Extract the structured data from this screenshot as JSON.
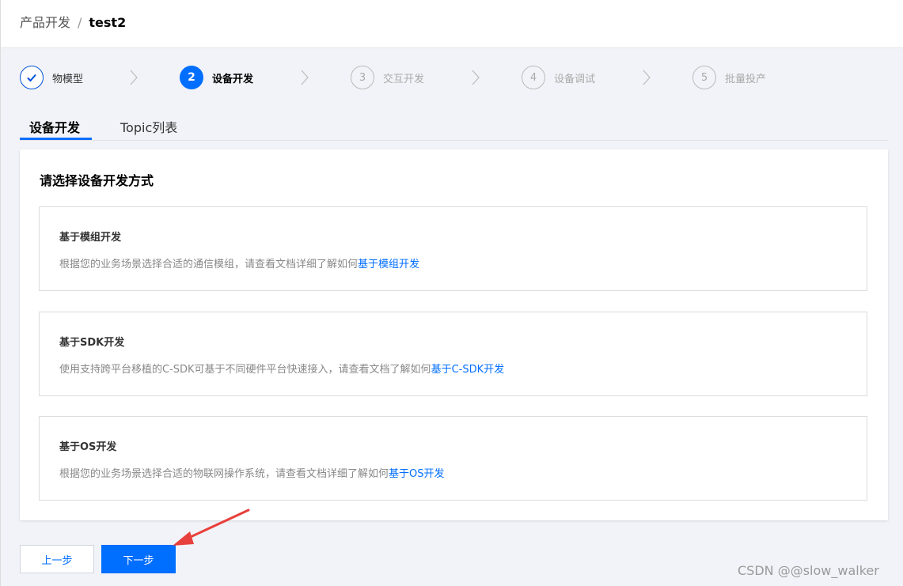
{
  "breadcrumb": {
    "parent": "产品开发",
    "separator": "/",
    "current": "test2"
  },
  "steps": [
    {
      "number": "1",
      "label": "物模型",
      "state": "done"
    },
    {
      "number": "2",
      "label": "设备开发",
      "state": "active"
    },
    {
      "number": "3",
      "label": "交互开发",
      "state": "todo"
    },
    {
      "number": "4",
      "label": "设备调试",
      "state": "todo"
    },
    {
      "number": "5",
      "label": "批量投产",
      "state": "todo"
    }
  ],
  "tabs": [
    {
      "label": "设备开发",
      "active": true
    },
    {
      "label": "Topic列表",
      "active": false
    }
  ],
  "panel": {
    "title": "请选择设备开发方式",
    "options": [
      {
        "title": "基于模组开发",
        "desc": "根据您的业务场景选择合适的通信模组，请查看文档详细了解如何",
        "link": "基于模组开发"
      },
      {
        "title": "基于SDK开发",
        "desc": "使用支持跨平台移植的C-SDK可基于不同硬件平台快速接入，请查看文档了解如何",
        "link": "基于C-SDK开发"
      },
      {
        "title": "基于OS开发",
        "desc": "根据您的业务场景选择合适的物联网操作系统，请查看文档详细了解如何",
        "link": "基于OS开发"
      }
    ]
  },
  "buttons": {
    "prev": "上一步",
    "next": "下一步"
  },
  "watermark": "CSDN @@slow_walker",
  "colors": {
    "primary": "#006eff",
    "annotation_arrow": "#e8403c"
  }
}
